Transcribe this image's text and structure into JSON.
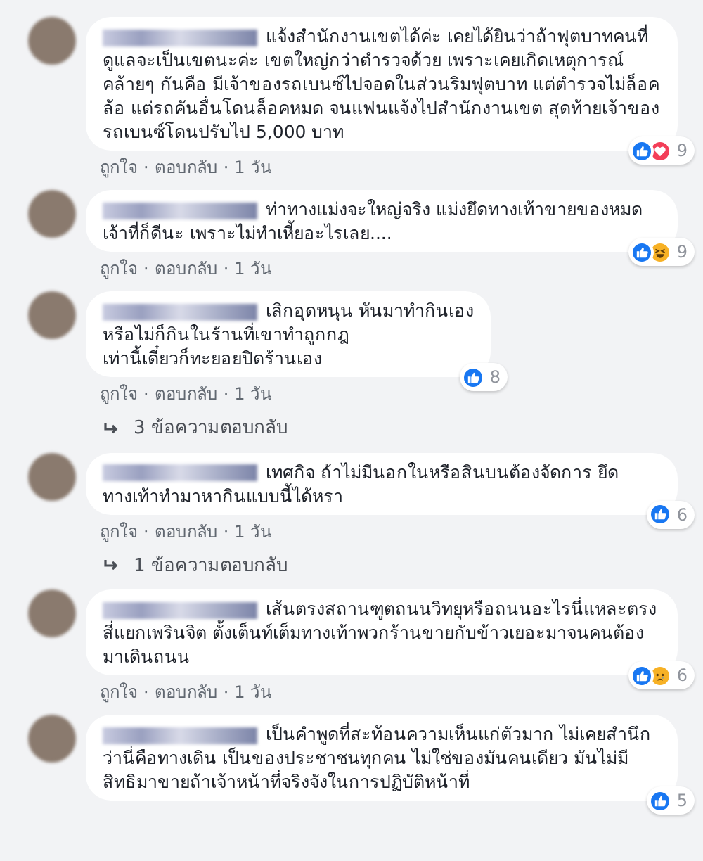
{
  "comments": [
    {
      "text": "แจ้งสำนักงานเขตได้ค่ะ เคยได้ยินว่าถ้าฟุตบาทคนที่ดูแลจะเป็นเขตนะค่ะ เขตใหญ่กว่าตำรวจด้วย เพราะเคยเกิดเหตุการณ์ คล้ายๆ กันคือ มีเจ้าของรถเบนซ์ไปจอดในส่วนริมฟุตบาท แต่ตำรวจไม่ล็อคล้อ แต่รถคันอื่นโดนล็อคหมด จนแฟนแจ้งไปสำนักงานเขต สุดท้ายเจ้าของรถเบนซ์โดนปรับไป 5,000 บาท",
      "reactions": [
        {
          "kind": "like"
        },
        {
          "kind": "love"
        }
      ],
      "count": "9",
      "actions": [
        "ถูกใจ",
        "·",
        "ตอบกลับ",
        "·",
        "1 วัน"
      ]
    },
    {
      "text": "ท่าทางแม่งจะใหญ่จริง แม่งยึดทางเท้าขายของหมด เจ้าที่ก็ดีนะ เพราะไม่ทำเหี้ยอะไรเลย....",
      "reactions": [
        {
          "kind": "like"
        },
        {
          "kind": "haha"
        }
      ],
      "count": "9",
      "actions": [
        "ถูกใจ",
        "·",
        "ตอบกลับ",
        "·",
        "1 วัน"
      ]
    },
    {
      "text": "เลิกอุดหนุน หันมาทำกินเอง\nหรือไม่ก็กินในร้านที่เขาทำถูกกฎ\nเท่านี้เดี๋ยวก็ทะยอยปิดร้านเอง",
      "reactions": [
        {
          "kind": "like"
        }
      ],
      "count": "8",
      "actions": [
        "ถูกใจ",
        "·",
        "ตอบกลับ",
        "·",
        "1 วัน"
      ],
      "replies": "3 ข้อความตอบกลับ"
    },
    {
      "text": "เทศกิจ ถ้าไม่มีนอกในหรือสินบนต้องจัดการ ยึดทางเท้าทำมาหากินแบบนี้ได้หรา",
      "reactions": [
        {
          "kind": "like"
        }
      ],
      "count": "6",
      "actions": [
        "ถูกใจ",
        "·",
        "ตอบกลับ",
        "·",
        "1 วัน"
      ],
      "replies": "1 ข้อความตอบกลับ"
    },
    {
      "text": "เส้นตรงสถานฑูตถนนวิทยุหรือถนนอะไรนี่แหละตรงสี่แยกเพรินจิต ตั้งเต็นท์เต็มทางเท้าพวกร้านขายกับข้าวเยอะมาจนคนต้องมาเดินถนน",
      "reactions": [
        {
          "kind": "like"
        },
        {
          "kind": "sad"
        }
      ],
      "count": "6",
      "actions": [
        "ถูกใจ",
        "·",
        "ตอบกลับ",
        "·",
        "1 วัน"
      ]
    },
    {
      "text": "เป็นคำพูดที่สะท้อนความเห็นแก่ตัวมาก ไม่เคยสำนึกว่านี่คือทางเดิน เป็นของประชาชนทุกคน ไม่ใช่ของมันคนเดียว มันไม่มีสิทธิมาขายถ้าเจ้าหน้าที่จริงจังในการปฏิบัติหน้าที่",
      "reactions": [
        {
          "kind": "like"
        }
      ],
      "count": "5"
    }
  ]
}
